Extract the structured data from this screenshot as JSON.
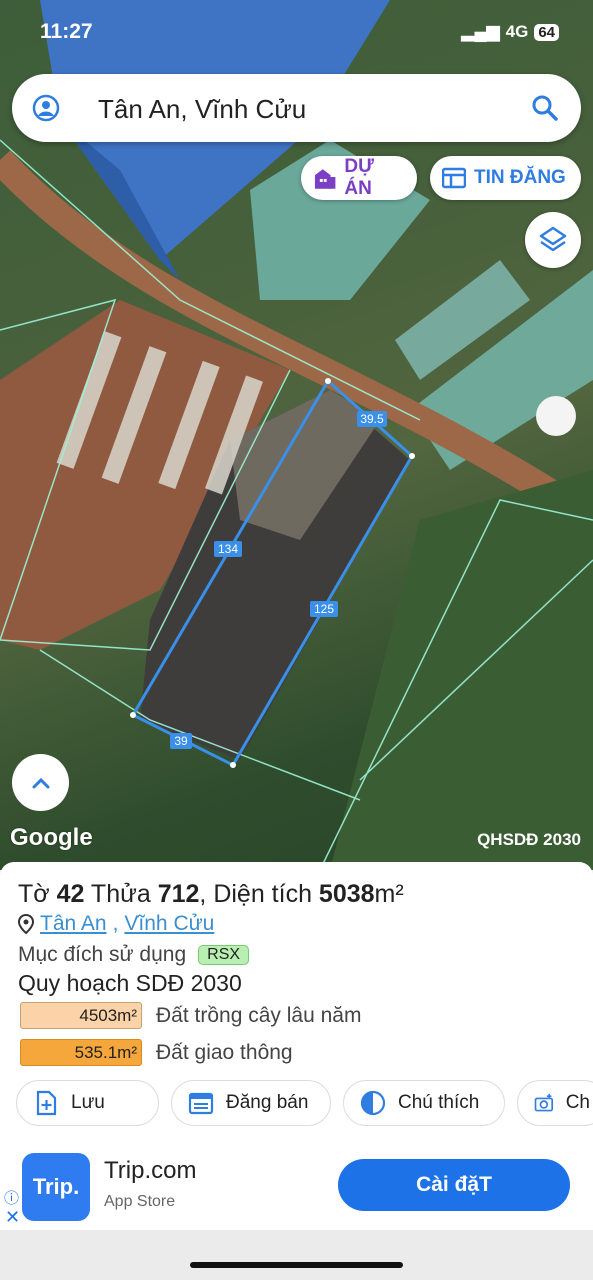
{
  "status": {
    "time": "11:27",
    "network": "4G",
    "battery": "64"
  },
  "search": {
    "text": "Tân An, Vĩnh Cửu"
  },
  "chips": {
    "project": "DỰ ÁN",
    "listing": "TIN ĐĂNG"
  },
  "map": {
    "google_label": "Google",
    "layer_tag": "QHSDĐ 2030",
    "dimensions": {
      "top": "39.5",
      "left": "134",
      "right": "125",
      "bottom": "39"
    }
  },
  "parcel": {
    "title_prefix": "Tờ ",
    "sheet": "42",
    "lot_label": " Thửa ",
    "lot": "712",
    "area_label": ", Diện tích ",
    "area": "5038",
    "area_unit": "m²",
    "ward": "Tân An",
    "district": "Vĩnh Cửu",
    "purpose_label": "Mục đích sử dụng",
    "purpose_code": "RSX",
    "plan_title": "Quy hoạch SDĐ 2030",
    "zones": [
      {
        "area": "4503m²",
        "label": "Đất trồng cây lâu năm",
        "color": "#fcd3a8"
      },
      {
        "area": "535.1m²",
        "label": "Đất giao thông",
        "color": "#f6a73b"
      }
    ]
  },
  "actions": [
    {
      "label": "Lưu",
      "icon": "save-icon"
    },
    {
      "label": "Đăng bán",
      "icon": "calendar-icon"
    },
    {
      "label": "Chú thích",
      "icon": "contrast-icon"
    },
    {
      "label": "Ch",
      "icon": "camera-icon"
    }
  ],
  "ad": {
    "logo": "Trip.",
    "name": "Trip.com",
    "store": "App Store",
    "cta": "Cài đặT"
  },
  "colors": {
    "accent": "#1c72e6",
    "chip_purple": "#7b3fc4",
    "chip_blue": "#2f7de0",
    "parcel_line": "#3a8fe8"
  }
}
